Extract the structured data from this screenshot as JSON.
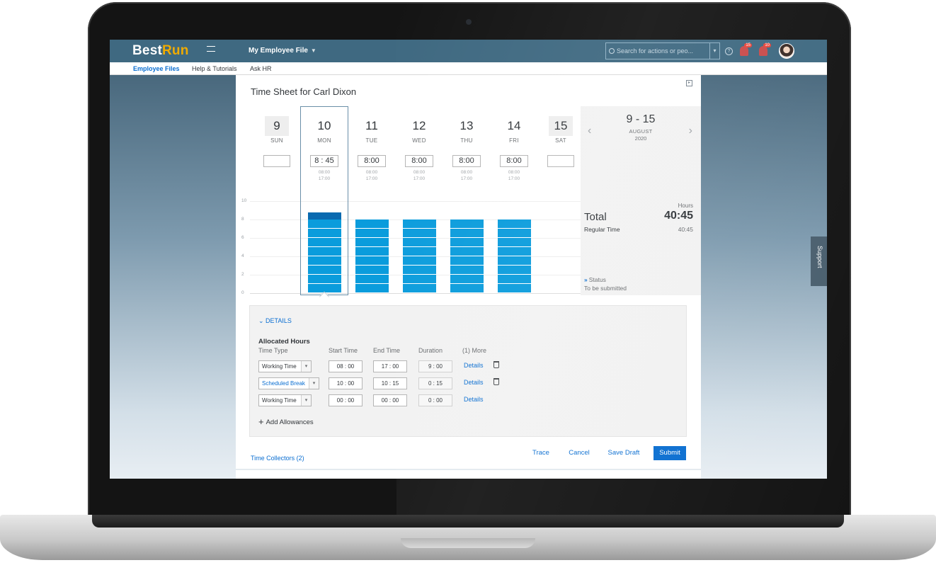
{
  "shell": {
    "logo_best": "Best",
    "logo_run": "Run",
    "app_menu": "My Employee File",
    "search_placeholder": "Search for actions or peo...",
    "notification_count_1": "15",
    "notification_count_2": "10"
  },
  "subnav": {
    "items": [
      "Employee Files",
      "Help & Tutorials",
      "Ask HR"
    ]
  },
  "timesheet": {
    "title": "Time Sheet for Carl Dixon",
    "days": [
      {
        "num": "9",
        "name": "SUN",
        "time": "",
        "plan_start": "",
        "plan_end": "",
        "weekend": true
      },
      {
        "num": "10",
        "name": "MON",
        "time": "8 : 45",
        "plan_start": "08:00",
        "plan_end": "17:00",
        "weekend": false
      },
      {
        "num": "11",
        "name": "TUE",
        "time": "8:00",
        "plan_start": "08:00",
        "plan_end": "17:00",
        "weekend": false
      },
      {
        "num": "12",
        "name": "WED",
        "time": "8:00",
        "plan_start": "08:00",
        "plan_end": "17:00",
        "weekend": false
      },
      {
        "num": "13",
        "name": "THU",
        "time": "8:00",
        "plan_start": "08:00",
        "plan_end": "17:00",
        "weekend": false
      },
      {
        "num": "14",
        "name": "FRI",
        "time": "8:00",
        "plan_start": "08:00",
        "plan_end": "17:00",
        "weekend": false
      },
      {
        "num": "15",
        "name": "SAT",
        "time": "",
        "plan_start": "",
        "plan_end": "",
        "weekend": true
      }
    ],
    "chart": {
      "y_ticks": [
        "10",
        "8",
        "6",
        "4",
        "2",
        "0"
      ],
      "y_max": 10,
      "hours": [
        8.75,
        8,
        8,
        8,
        8
      ]
    },
    "summary": {
      "range": "9 - 15",
      "month": "AUGUST",
      "year": "2020",
      "prev": "‹",
      "next": "›",
      "hours_label": "Hours",
      "total_label": "Total",
      "total_value": "40:45",
      "regular_label": "Regular Time",
      "regular_value": "40:45",
      "status_label": "Status",
      "status_value": "To be submitted"
    },
    "details": {
      "toggle": "DETAILS",
      "title": "Allocated Hours",
      "columns": [
        "Time Type",
        "Start Time",
        "End Time",
        "Duration",
        "(1) More"
      ],
      "rows": [
        {
          "type": "Working Time",
          "start_h": "08",
          "start_m": "00",
          "end_h": "17",
          "end_m": "00",
          "dur_h": "9",
          "dur_m": "00",
          "link": "Details"
        },
        {
          "type": "Scheduled Break",
          "start_h": "10",
          "start_m": "00",
          "end_h": "10",
          "end_m": "15",
          "dur_h": "0",
          "dur_m": "15",
          "link": "Details"
        },
        {
          "type": "Working Time",
          "start_h": "00",
          "start_m": "00",
          "end_h": "00",
          "end_m": "00",
          "dur_h": "0",
          "dur_m": "00",
          "link": "Details"
        }
      ],
      "add_allowances": "Add Allowances"
    },
    "footer": {
      "time_collectors": "Time Collectors (2)",
      "trace": "Trace",
      "cancel": "Cancel",
      "save_draft": "Save Draft",
      "submit": "Submit"
    }
  },
  "support_tab": "Support"
}
